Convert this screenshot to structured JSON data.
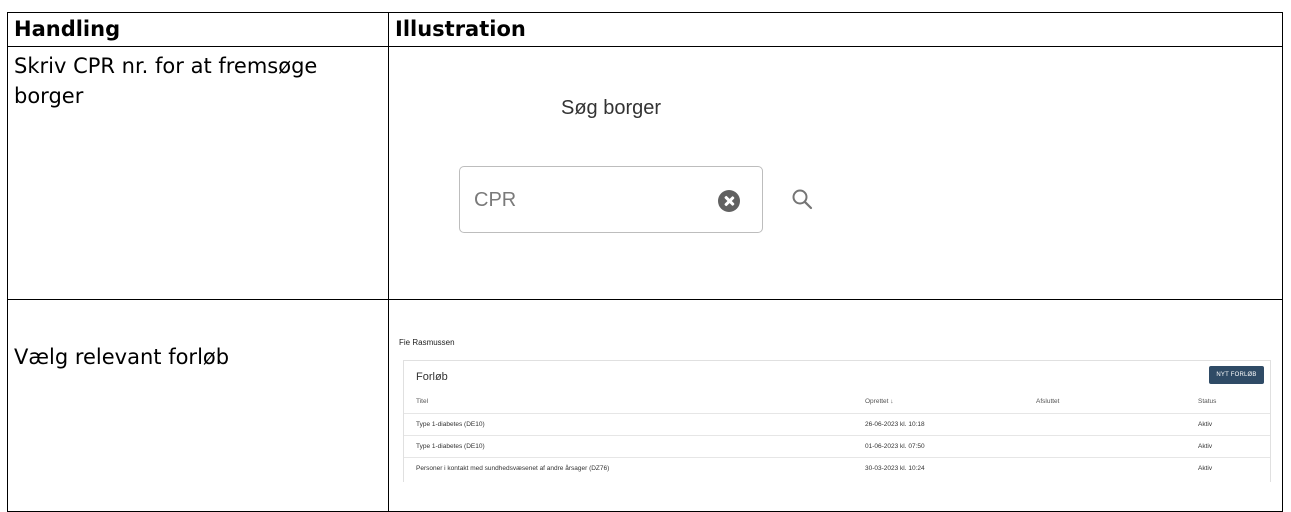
{
  "table": {
    "headers": [
      "Handling",
      "Illustration"
    ],
    "rows": [
      {
        "action": "Skriv CPR nr. for at fremsøge borger"
      },
      {
        "action": "Vælg relevant forløb"
      }
    ]
  },
  "search": {
    "title": "Søg borger",
    "cpr_placeholder": "CPR"
  },
  "forloeb": {
    "person_name": "Fie Rasmussen",
    "panel_title": "Forløb",
    "new_button": "NYT FORLØB",
    "columns": {
      "title": "Titel",
      "created": "Oprettet ↓",
      "ended": "Afsluttet",
      "status": "Status"
    },
    "rows": [
      {
        "title": "Type 1-diabetes (DE10)",
        "created": "26-06-2023 kl. 10:18",
        "ended": "",
        "status": "Aktiv"
      },
      {
        "title": "Type 1-diabetes (DE10)",
        "created": "01-06-2023 kl. 07:50",
        "ended": "",
        "status": "Aktiv"
      },
      {
        "title": "Personer i kontakt med sundhedsvæsenet af andre årsager (DZ76)",
        "created": "30-03-2023 kl. 10:24",
        "ended": "",
        "status": "Aktiv"
      }
    ]
  }
}
